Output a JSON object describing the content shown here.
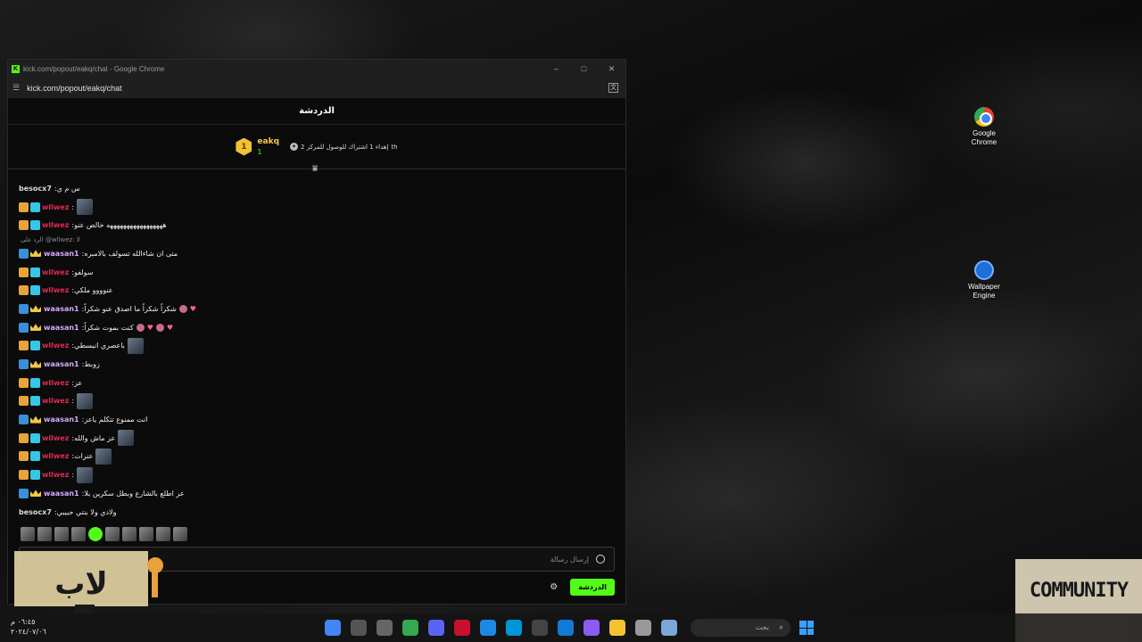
{
  "desktop": {
    "icons": [
      {
        "label_line1": "Google",
        "label_line2": "Chrome"
      },
      {
        "label_line1": "Wallpaper",
        "label_line2": "Engine"
      }
    ],
    "community_text": "COMMUNITY"
  },
  "window": {
    "title": "kick.com/popout/eakq/chat - Google Chrome",
    "url": "kick.com/popout/eakq/chat",
    "controls": {
      "minimize": "–",
      "maximize": "□",
      "close": "✕"
    }
  },
  "chat": {
    "header_title": "الدردشة",
    "pinned": {
      "badge": "1",
      "username": "eakq",
      "count": "1",
      "text": "إهداء 1 اشتراك للوصول للمركز 2",
      "suffix": "th"
    },
    "reply_hint": "الرد على @wllwez: لا",
    "messages": [
      {
        "user": "besocx7",
        "sep": ":",
        "text": "س م ي",
        "kind": "besocx"
      },
      {
        "user": "wllwez",
        "sep": ":",
        "text": "",
        "kind": "wllwez",
        "emote": true
      },
      {
        "user": "wllwez",
        "sep": ":",
        "text": "هههههههههههههههههه خالص عنو",
        "kind": "wllwez"
      },
      {
        "user": "waasan1",
        "sep": ":",
        "text": "متى ان شاءالله تسولف بالامبره",
        "kind": "waasan"
      },
      {
        "user": "wllwez",
        "sep": ":",
        "text": "سولفو",
        "kind": "wllwez"
      },
      {
        "user": "wllwez",
        "sep": ":",
        "text": "عنوووو ملكي",
        "kind": "wllwez"
      },
      {
        "user": "waasan1",
        "sep": ":",
        "text": "شكراً شكراً ما اصدق عنو شكراً",
        "kind": "waasan",
        "hearts": 1
      },
      {
        "user": "waasan1",
        "sep": ":",
        "text": "كنت بموت شكراً",
        "kind": "waasan",
        "hearts": 2
      },
      {
        "user": "wllwez",
        "sep": ":",
        "text": "باعصري انبسطي",
        "kind": "wllwez",
        "emote": true
      },
      {
        "user": "waasan1",
        "sep": ":",
        "text": "زوبط",
        "kind": "waasan"
      },
      {
        "user": "wllwez",
        "sep": ":",
        "text": "عز",
        "kind": "wllwez"
      },
      {
        "user": "wllwez",
        "sep": ":",
        "text": "",
        "kind": "wllwez",
        "emote": true
      },
      {
        "user": "waasan1",
        "sep": ":",
        "text": "انت ممنوع تتكلم ياعز",
        "kind": "waasan"
      },
      {
        "user": "wllwez",
        "sep": ":",
        "text": "عز ماش والله",
        "kind": "wllwez",
        "emote": true
      },
      {
        "user": "wllwez",
        "sep": ":",
        "text": "عنرات",
        "kind": "wllwez",
        "emote": true
      },
      {
        "user": "wllwez",
        "sep": ":",
        "text": "",
        "kind": "wllwez",
        "emote": true
      },
      {
        "user": "waasan1",
        "sep": ":",
        "text": "عز اطلع بالشارع وبطل سكرين بلا",
        "kind": "waasan"
      },
      {
        "user": "besocx7",
        "sep": ":",
        "text": "ولادي ولا بنتي حبيبي",
        "kind": "besocx"
      }
    ],
    "input_placeholder": "إرسال رسالة",
    "send_label": "الدردشة"
  },
  "taskbar": {
    "time": "٠٦:٤٥ م",
    "date": "٢٠٢٤/٠٧/٠٦",
    "search_placeholder": "بحث"
  },
  "colors": {
    "kick_green": "#53fc18",
    "wllwez": "#e02b55",
    "waasan": "#d7a8ff",
    "pinned_name": "#f7c948"
  }
}
